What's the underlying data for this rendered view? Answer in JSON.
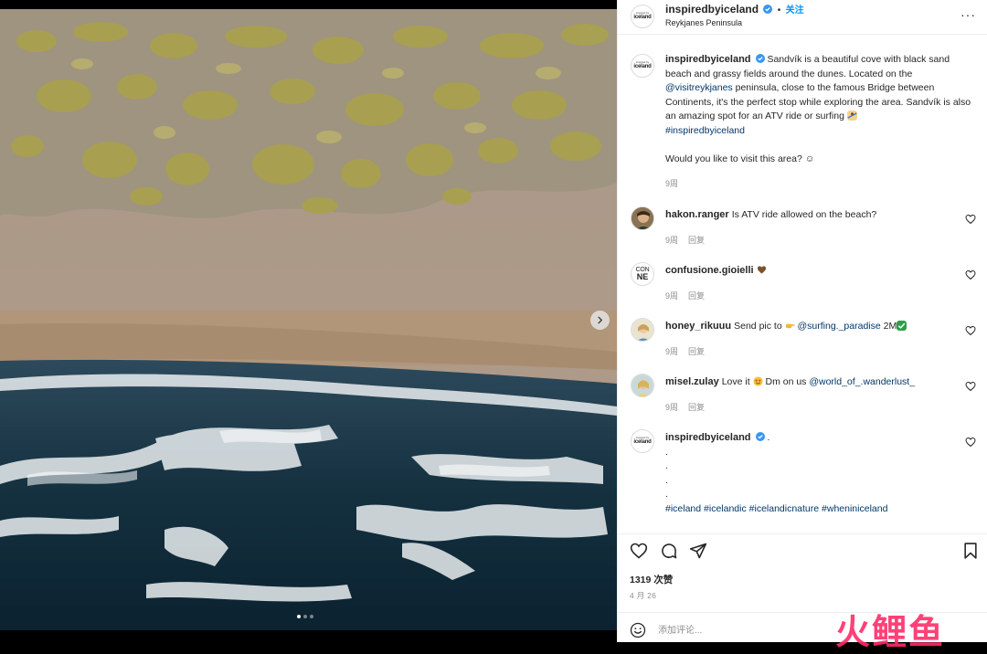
{
  "post": {
    "username": "inspiredbyiceland",
    "follow_label": "关注",
    "separator": "•",
    "location": "Reykjanes Peninsula",
    "more_label": "···",
    "logo_small": "inspired by",
    "logo_big": "iceland",
    "caption": {
      "username": "inspiredbyiceland",
      "text_1": " Sandvík is a beautiful cove with black sand beach and grassy fields around the dunes. Located on the ",
      "mention": "@visitreykjanes",
      "text_2": " peninsula, close to the famous Bridge between Continents, it's the perfect stop while exploring the area. Sandvík is also an amazing spot for an ATV ride or surfing ",
      "hashtag": "#inspiredbyiceland",
      "question": "Would you like to visit this area? ☺",
      "time": "9周"
    },
    "comments": [
      {
        "username": "hakon.ranger",
        "text_1": "Is ATV ride allowed on the beach?",
        "time": "9周",
        "reply": "回复"
      },
      {
        "username": "confusione.gioielli",
        "text_1": "",
        "time": "9周",
        "reply": "回复",
        "avatar_line1": "CON",
        "avatar_line2": "NE"
      },
      {
        "username": "honey_rikuuu",
        "text_1": "Send pic to ",
        "mention": "@surfing._paradise",
        "text_2": " 2M",
        "time": "9周",
        "reply": "回复"
      },
      {
        "username": "misel.zulay",
        "text_1": "Love it ",
        "text_2": " Dm on us ",
        "mention": "@world_of_.wanderlust_",
        "time": "9周",
        "reply": "回复"
      }
    ],
    "second_caption": {
      "username": "inspiredbyiceland",
      "text_1": " .",
      "dots": [
        ".",
        ".",
        ".",
        "."
      ],
      "hashtags": "#iceland #icelandic #icelandicnature #wheniniceland"
    },
    "likes": "1319 次赞",
    "date": "4 月 26",
    "add_comment_placeholder": "添加评论...",
    "carousel": {
      "current": 1,
      "total": 3
    }
  },
  "watermark": "火鲤鱼",
  "colors": {
    "accent": "#0095f6",
    "verified": "#3897f0",
    "text": "#262626",
    "muted": "#8e8e8e",
    "watermark": "#ff2d6a"
  }
}
